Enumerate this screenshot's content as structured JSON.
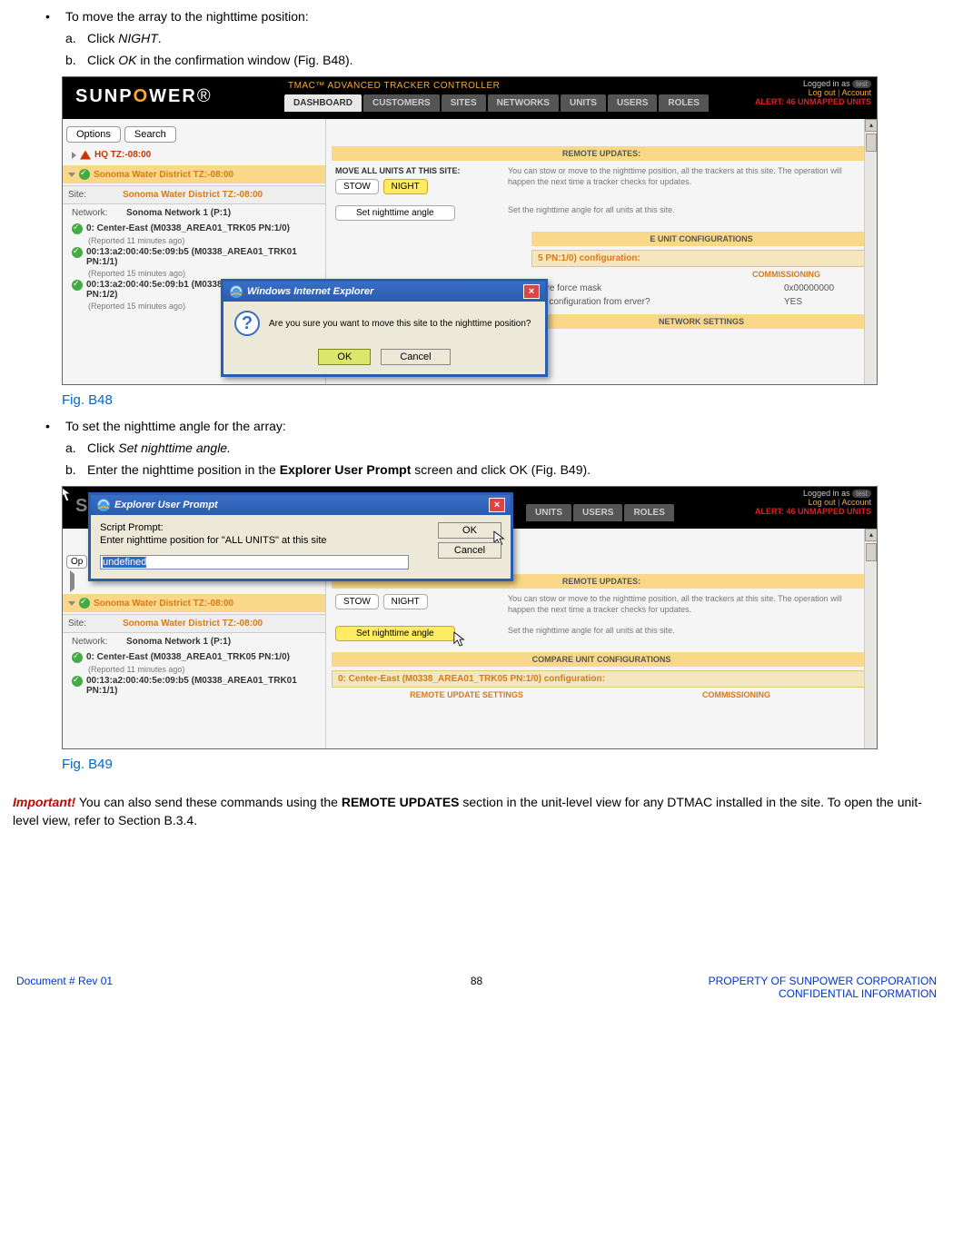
{
  "doc": {
    "bullet1": "To move the array to the nighttime position:",
    "b1a_label": "a.",
    "b1a_pre": "Click ",
    "b1a_em": "NIGHT",
    "b1a_post": ".",
    "b1b_label": "b.",
    "b1b_pre": "Click ",
    "b1b_em": "OK",
    "b1b_post": " in the confirmation window (Fig. B48).",
    "figB48": "Fig. B48",
    "bullet2": "To set the nighttime angle for the array:",
    "b2a_label": "a.",
    "b2a_pre": "Click ",
    "b2a_em": "Set nighttime angle.",
    "b2b_label": "b.",
    "b2b_text_pre": "Enter the nighttime position in the ",
    "b2b_bold": "Explorer User Prompt",
    "b2b_text_post": " screen and click OK (Fig. B49).",
    "figB49": "Fig. B49",
    "important_lead": "Important!",
    "important_pre": " You can also send these commands using the ",
    "important_bold": "REMOTE UPDATES",
    "important_post": " section in the unit-level view for any DTMAC installed in the site. To open the unit-level view, refer to Section B.3.4.",
    "footer_left": "Document #  Rev 01",
    "footer_center": "88",
    "footer_right1": "PROPERTY OF SUNPOWER CORPORATION",
    "footer_right2": "CONFIDENTIAL INFORMATION"
  },
  "app": {
    "logo_a": "SUNP",
    "logo_b": "O",
    "logo_c": "WER",
    "title": "TMAC™ ADVANCED TRACKER CONTROLLER",
    "tabs": [
      "DASHBOARD",
      "CUSTOMERS",
      "SITES",
      "NETWORKS",
      "UNITS",
      "USERS",
      "ROLES"
    ],
    "login_pre": "Logged in as ",
    "login_user": "test",
    "logout": "Log out",
    "account": "Account",
    "alert": "ALERT: 46 UNMAPPED UNITS",
    "options": "Options",
    "search": "Search",
    "hq": "HQ TZ:-08:00",
    "sonoma": "Sonoma Water District TZ:-08:00",
    "site_label": "Site:",
    "site_val": "Sonoma Water District TZ:-08:00",
    "net_label": "Network:",
    "net_val": "Sonoma Network 1 (P:1)",
    "dev0": "0: Center-East (M0338_AREA01_TRK05 PN:1/0)",
    "dev0_rep": "(Reported 11 minutes ago)",
    "dev1": "00:13:a2:00:40:5e:09:b5 (M0338_AREA01_TRK01 PN:1/1)",
    "dev1_rep": "(Reported 15 minutes ago)",
    "dev2": "00:13:a2:00:40:5e:09:b1 (M0338_AREA01_TRK02 PN:1/2)",
    "dev2_rep": "(Reported 15 minutes ago)",
    "dev1b": "00:13:a2:00:40:5e:09:b5 (M0338_AREA01_TRK01 PN:1/1)",
    "remote_updates": "REMOTE UPDATES:",
    "move_all": "MOVE ALL UNITS AT THIS SITE:",
    "stow": "STOW",
    "night": "NIGHT",
    "stow_desc": "You can stow or move to the nighttime position, all the trackers at this site. The operation will happen the next time a tracker checks for updates.",
    "set_night": "Set nighttime angle",
    "set_night_desc": "Set the nighttime angle for all units at this site.",
    "compare": "COMPARE UNIT CONFIGURATIONS",
    "compare_partial": "E UNIT CONFIGURATIONS",
    "net_settings": "NETWORK SETTINGS",
    "config_head": "0: Center-East (M0338_AREA01_TRK05 PN:1/0) configuration:",
    "config_head_partial": "5 PN:1/0) configuration:",
    "subhead_remote": "REMOTE UPDATE SETTINGS",
    "subhead_comm": "COMMISSIONING",
    "force_k": "ntire force mask",
    "force_v": "0x00000000",
    "writecfg_k": "ite configuration from erver?",
    "writecfg_v": "YES"
  },
  "ie": {
    "title": "Windows Internet Explorer",
    "msg": "Are you sure you want to move this site to the nighttime position?",
    "ok": "OK",
    "cancel": "Cancel"
  },
  "prompt": {
    "title": "Explorer User Prompt",
    "label": "Script Prompt:",
    "text": "Enter nighttime position for \"ALL UNITS\" at this site",
    "value": "undefined",
    "ok": "OK",
    "cancel": "Cancel"
  }
}
